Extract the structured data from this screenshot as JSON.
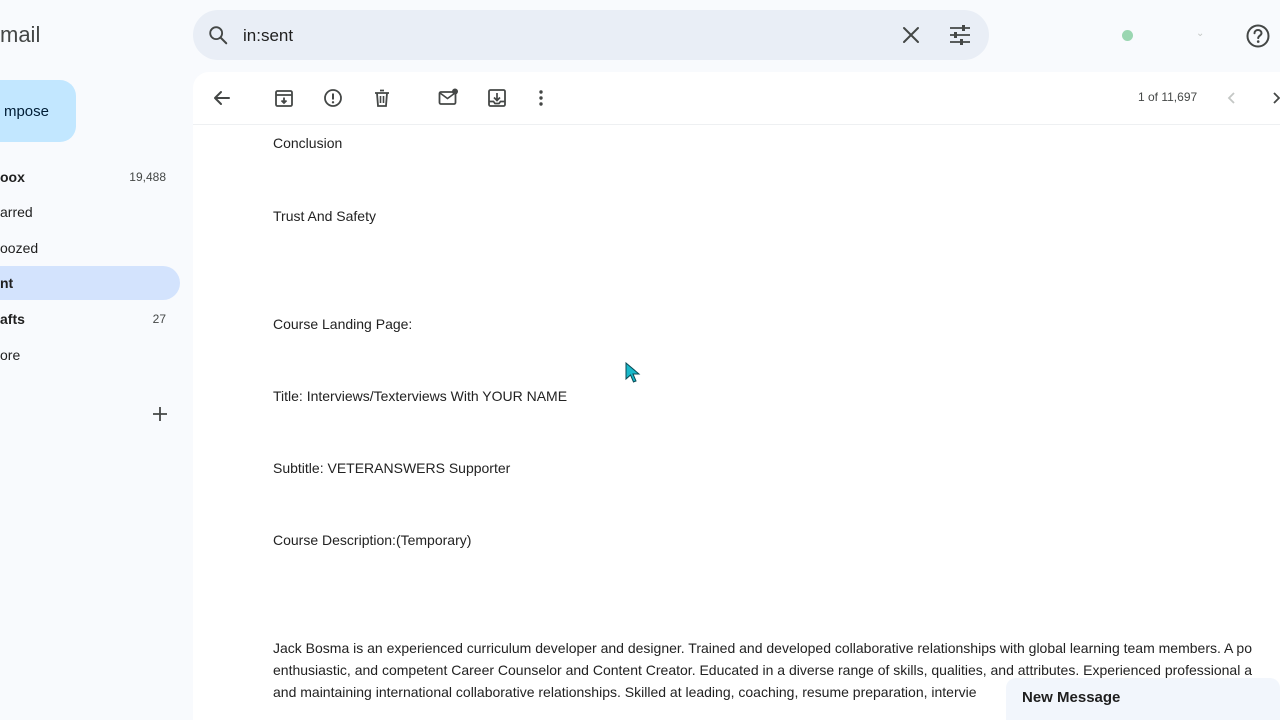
{
  "app": {
    "logo_text": "mail"
  },
  "compose": {
    "label": "mpose"
  },
  "sidebar": {
    "items": [
      {
        "label": "oox",
        "count": "19,488"
      },
      {
        "label": "arred",
        "count": ""
      },
      {
        "label": "oozed",
        "count": ""
      },
      {
        "label": "nt",
        "count": ""
      },
      {
        "label": "afts",
        "count": "27"
      },
      {
        "label": "ore",
        "count": ""
      }
    ]
  },
  "search": {
    "query": "in:sent"
  },
  "toolbar": {
    "page_count": "1 of 11,697"
  },
  "email": {
    "lines": [
      "Conclusion",
      "Trust And Safety",
      "Course Landing Page:",
      "Title: Interviews/Texterviews With YOUR NAME",
      "Subtitle: VETERANSWERS Supporter",
      "Course Description:(Temporary)"
    ],
    "paragraph": [
      "Jack Bosma is an experienced curriculum developer and designer. Trained and developed collaborative relationships with global learning team members. A po",
      "enthusiastic, and competent Career Counselor and Content Creator. Educated in a diverse range of skills, qualities, and attributes. Experienced professional a",
      "and maintaining international collaborative relationships. Skilled at leading, coaching, resume preparation, intervie"
    ]
  },
  "compose_window": {
    "title": "New Message"
  },
  "colors": {
    "background": "#f8fafd",
    "compose_bg": "#c2e7ff",
    "active_nav_bg": "#d3e3fd",
    "search_bg": "#e9eef6",
    "status_dot": "#9ad6b1"
  },
  "icons": [
    "search-icon",
    "close-icon",
    "filter-icon",
    "help-icon",
    "back-icon",
    "archive-icon",
    "report-spam-icon",
    "delete-icon",
    "mark-unread-icon",
    "move-to-icon",
    "more-vert-icon",
    "chevron-left-icon",
    "chevron-right-icon",
    "plus-icon",
    "cursor-icon"
  ]
}
